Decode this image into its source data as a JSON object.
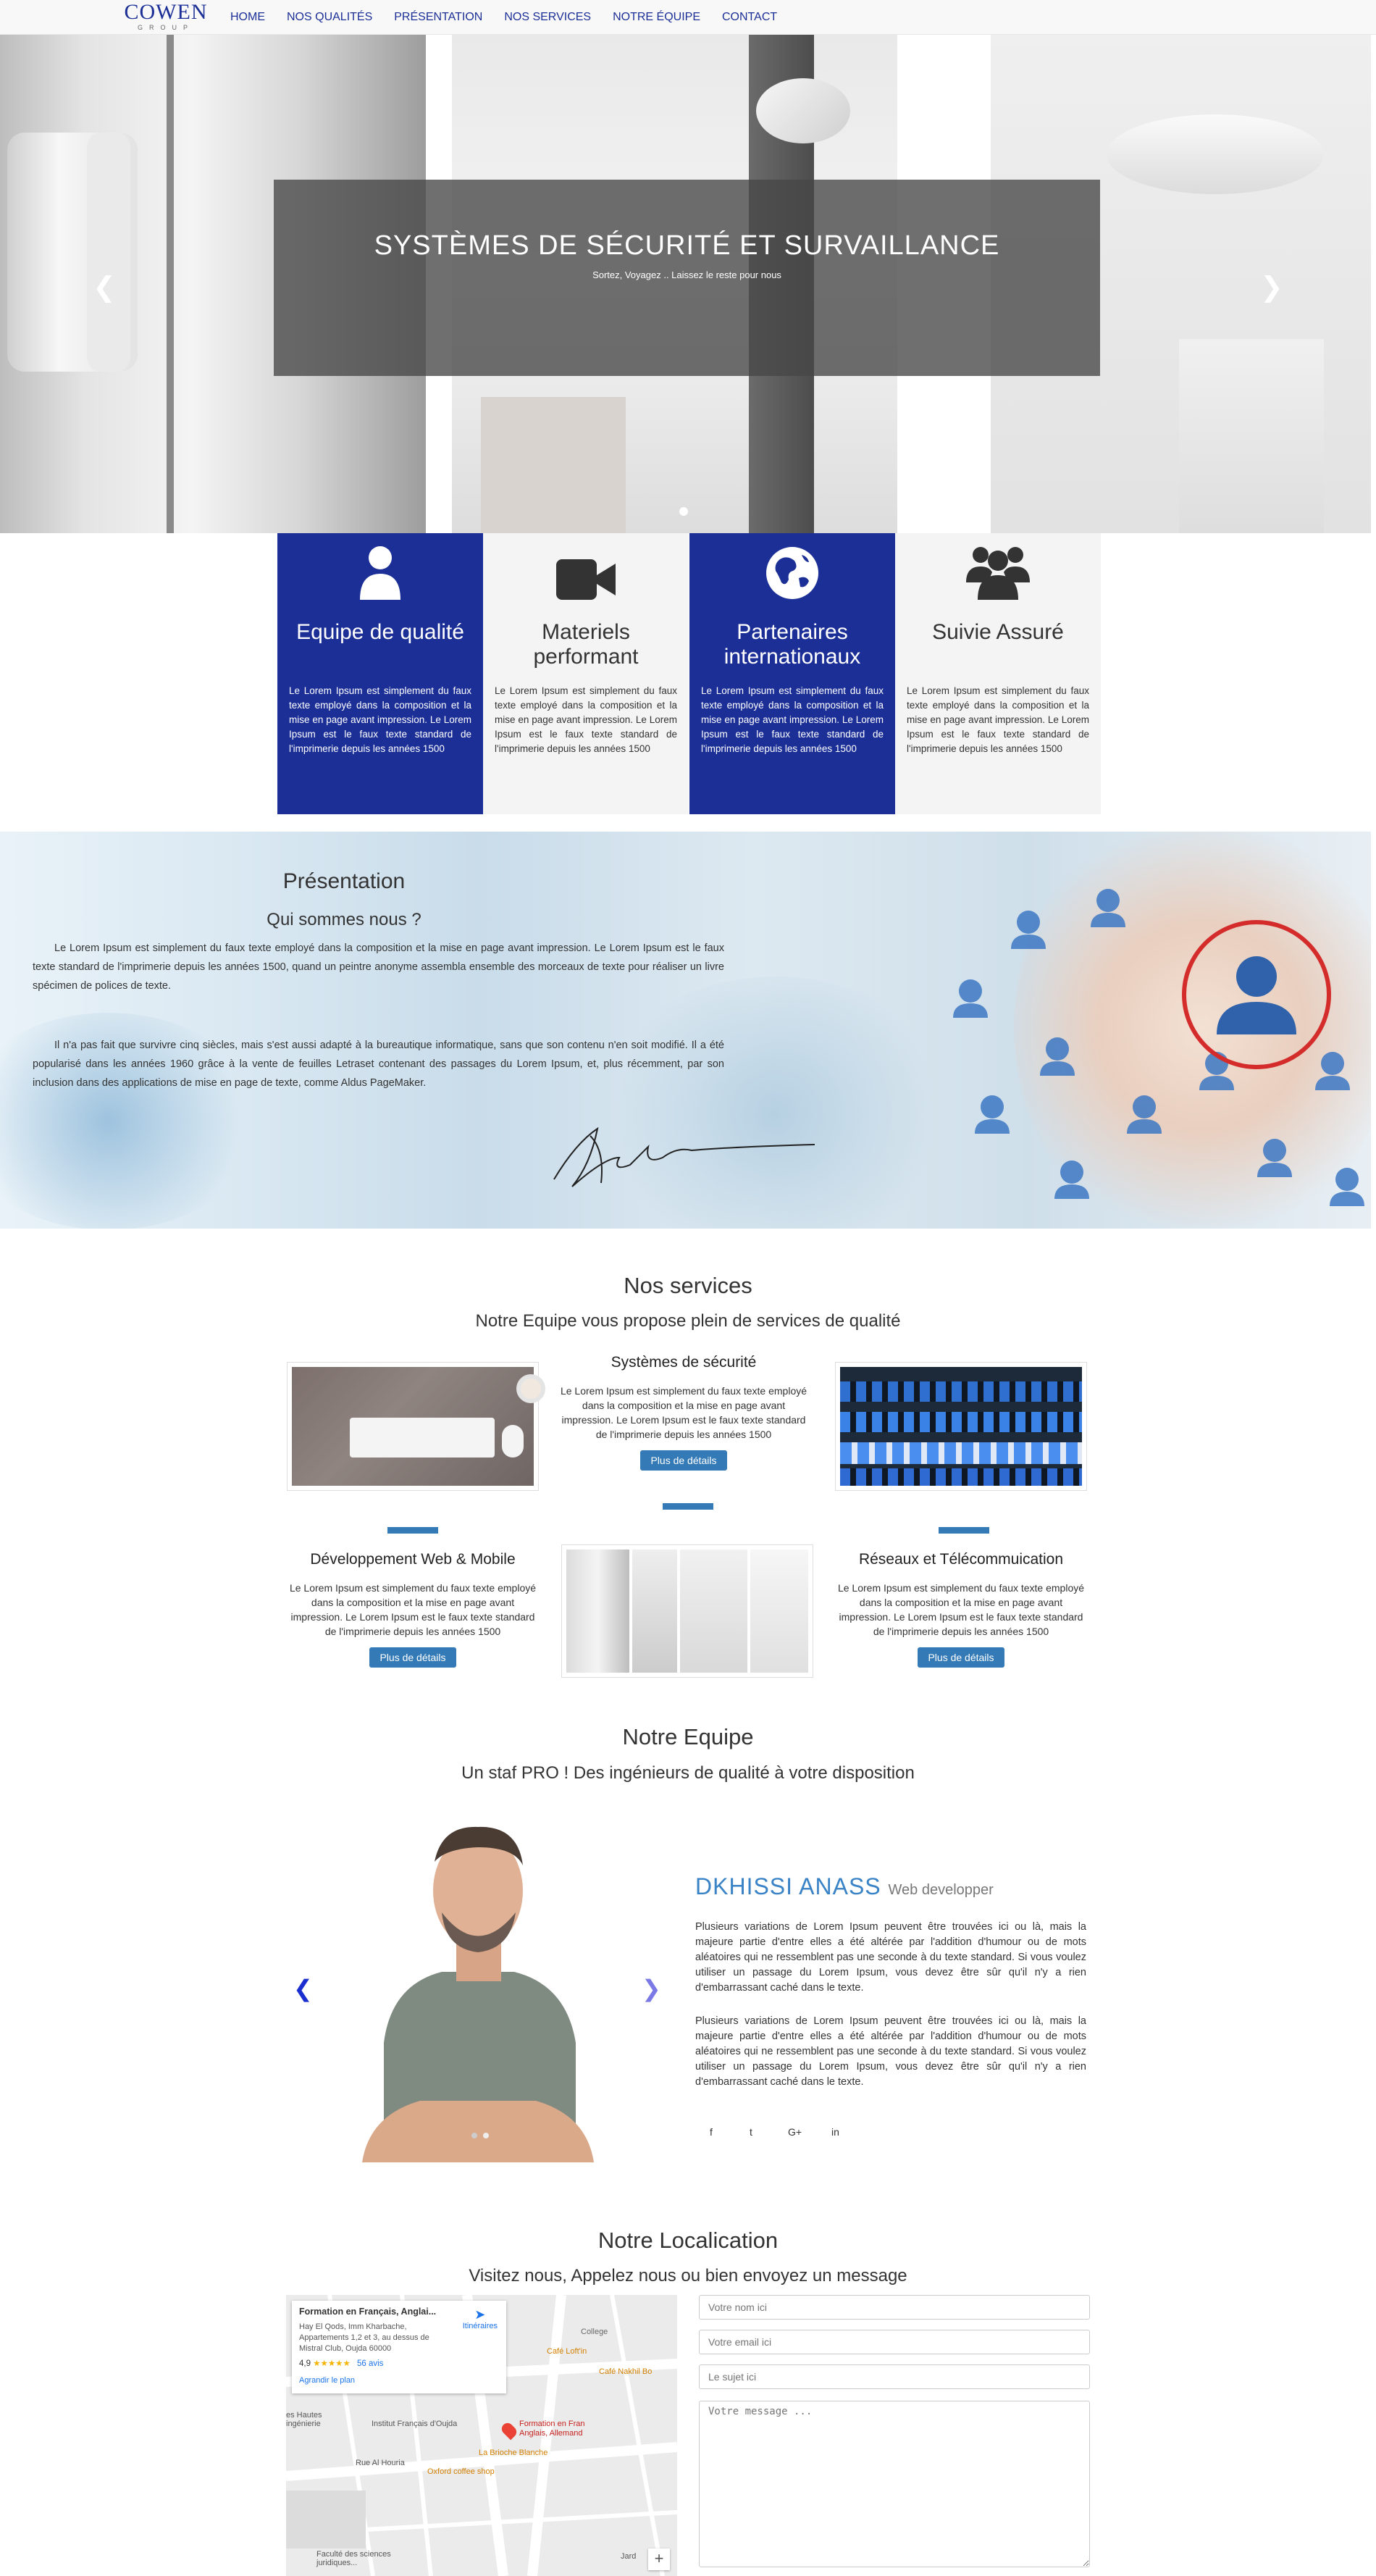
{
  "nav": {
    "logo_main": "COWEN",
    "logo_sub": "GROUP",
    "items": [
      "HOME",
      "NOS QUALITÉS",
      "PRÉSENTATION",
      "NOS SERVICES",
      "NOTRE ÉQUIPE",
      "CONTACT"
    ]
  },
  "hero": {
    "title": "SYSTÈMES DE SÉCURITÉ ET SURVAILLANCE",
    "subtitle": "Sortez, Voyagez .. Laissez le reste pour nous",
    "prev_icon": "chevron-left-icon",
    "next_icon": "chevron-right-icon",
    "slide_count": 2
  },
  "features": [
    {
      "title": "Equipe de qualité",
      "icon": "user-icon",
      "text": "Le Lorem Ipsum est simplement du faux texte employé dans la composition et la mise en page avant impression. Le Lorem Ipsum est le faux texte standard de l'imprimerie depuis les années 1500"
    },
    {
      "title": "Materiels performant",
      "icon": "video-camera-icon",
      "text": "Le Lorem Ipsum est simplement du faux texte employé dans la composition et la mise en page avant impression. Le Lorem Ipsum est le faux texte standard de l'imprimerie depuis les années 1500"
    },
    {
      "title": "Partenaires internationaux",
      "icon": "globe-icon",
      "text": "Le Lorem Ipsum est simplement du faux texte employé dans la composition et la mise en page avant impression. Le Lorem Ipsum est le faux texte standard de l'imprimerie depuis les années 1500"
    },
    {
      "title": "Suivie Assuré",
      "icon": "group-icon",
      "text": "Le Lorem Ipsum est simplement du faux texte employé dans la composition et la mise en page avant impression. Le Lorem Ipsum est le faux texte standard de l'imprimerie depuis les années 1500"
    }
  ],
  "presentation": {
    "title": "Présentation",
    "subtitle": "Qui sommes nous ?",
    "para1": "Le Lorem Ipsum est simplement du faux texte employé dans la composition et la mise en page avant impression. Le Lorem Ipsum est le faux texte standard de l'imprimerie depuis les années 1500, quand un peintre anonyme assembla ensemble des morceaux de texte pour réaliser un livre spécimen de polices de texte.",
    "para2": "Il n'a pas fait que survivre cinq siècles, mais s'est aussi adapté à la bureautique informatique, sans que son contenu n'en soit modifié. Il a été popularisé dans les années 1960 grâce à la vente de feuilles Letraset contenant des passages du Lorem Ipsum, et, plus récemment, par son inclusion dans des applications de mise en page de texte, comme Aldus PageMaker."
  },
  "services": {
    "title": "Nos services",
    "subtitle": "Notre Equipe vous propose plein de services de qualité",
    "items": [
      {
        "title": "Systèmes de sécurité",
        "text": "Le Lorem Ipsum est simplement du faux texte employé dans la composition et la mise en page avant impression. Le Lorem Ipsum est le faux texte standard de l'imprimerie depuis les années 1500",
        "button": "Plus de détails"
      },
      {
        "title": "Développement Web & Mobile",
        "text": "Le Lorem Ipsum est simplement du faux texte employé dans la composition et la mise en page avant impression. Le Lorem Ipsum est le faux texte standard de l'imprimerie depuis les années 1500",
        "button": "Plus de détails"
      },
      {
        "title": "Réseaux et Télécommuication",
        "text": "Le Lorem Ipsum est simplement du faux texte employé dans la composition et la mise en page avant impression. Le Lorem Ipsum est le faux texte standard de l'imprimerie depuis les années 1500",
        "button": "Plus de détails"
      }
    ]
  },
  "team": {
    "title": "Notre Equipe",
    "subtitle": "Un staf PRO ! Des ingénieurs de qualité à votre disposition",
    "name": "DKHISSI ANASS",
    "role": "Web developper",
    "para1": "Plusieurs variations de Lorem Ipsum peuvent être trouvées ici ou là, mais la majeure partie d'entre elles a été altérée par l'addition d'humour ou de mots aléatoires qui ne ressemblent pas une seconde à du texte standard. Si vous voulez utiliser un passage du Lorem Ipsum, vous devez être sûr qu'il n'y a rien d'embarrassant caché dans le texte.",
    "para2": "Plusieurs variations de Lorem Ipsum peuvent être trouvées ici ou là, mais la majeure partie d'entre elles a été altérée par l'addition d'humour ou de mots aléatoires qui ne ressemblent pas une seconde à du texte standard. Si vous voulez utiliser un passage du Lorem Ipsum, vous devez être sûr qu'il n'y a rien d'embarrassant caché dans le texte.",
    "social": [
      "f",
      "t",
      "G+",
      "in"
    ]
  },
  "location": {
    "title": "Notre Localication",
    "subtitle": "Visitez nous, Appelez nous ou bien envoyez un message",
    "map": {
      "place_name": "Formation en Français, Anglai...",
      "address": "Hay El Qods, Imm Kharbache, Appartements 1,2 et 3, au dessus de Mistral Club, Oujda 60000",
      "rating": "4,9",
      "stars": "★★★★★",
      "reviews": "56 avis",
      "directions": "Itinéraires",
      "enlarge": "Agrandir le plan",
      "labels": [
        "Café Loft'in",
        "College",
        "Café Nakhil Bo",
        "Institut Français d'Oujda",
        "Formation en Fran Anglais, Allemand",
        "La Brioche Blanche",
        "Oxford coffee shop",
        "Rue Al Houria",
        "es Hautes ingénierie",
        "Faculté des sciences juridiques...",
        "Jard"
      ],
      "zoom_in": "+"
    },
    "form": {
      "name_placeholder": "Votre nom ici",
      "email_placeholder": "Votre email ici",
      "subject_placeholder": "Le sujet ici",
      "message_placeholder": "Votre message ..."
    }
  }
}
